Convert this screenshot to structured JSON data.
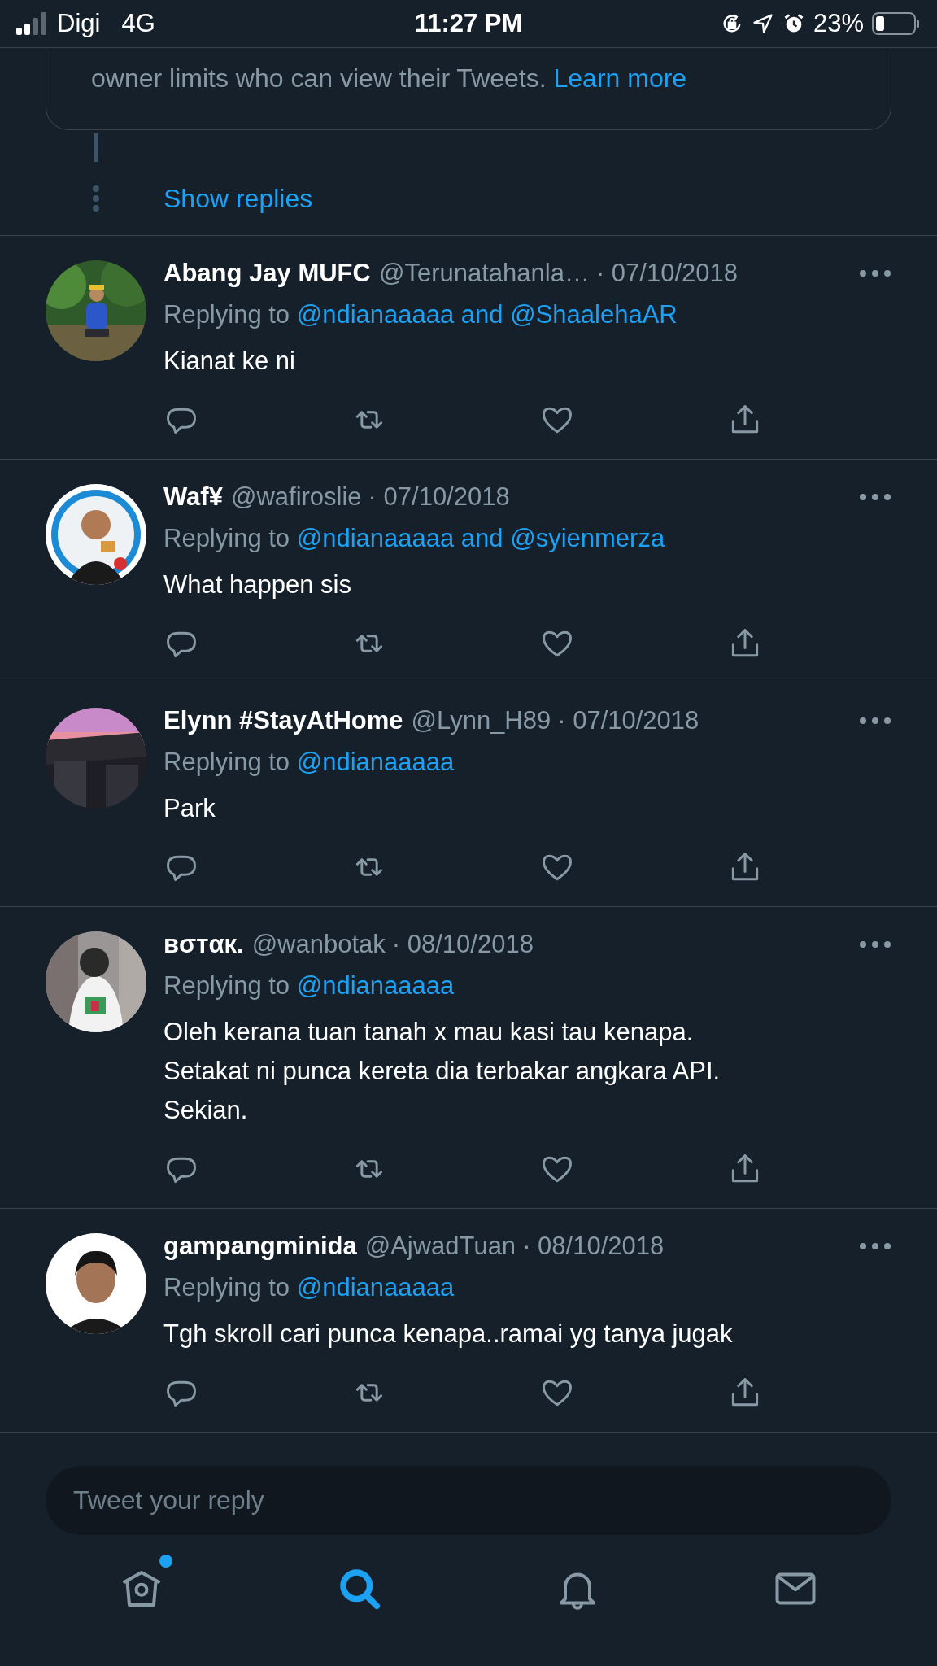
{
  "status_bar": {
    "carrier": "Digi",
    "network": "4G",
    "time": "11:27 PM",
    "battery": "23%"
  },
  "notice": {
    "text": "owner limits who can view their Tweets.",
    "link": "Learn more"
  },
  "show_replies": "Show replies",
  "tweets": [
    {
      "name": "Abang Jay MUFC",
      "handle": "@Terunatahanla…",
      "date": "· 07/10/2018",
      "replying_label": "Replying to",
      "replying_to": "@ndianaaaaa and @ShaalehaAR",
      "text": "Kianat ke ni"
    },
    {
      "name": "Waf¥",
      "handle": "@wafiroslie",
      "date": "· 07/10/2018",
      "replying_label": "Replying to",
      "replying_to": "@ndianaaaaa and @syienmerza",
      "text": "What happen sis"
    },
    {
      "name": "Elynn #StayAtHome",
      "handle": "@Lynn_H89",
      "date": "· 07/10/2018",
      "replying_label": "Replying to",
      "replying_to": "@ndianaaaaa",
      "text": "Park"
    },
    {
      "name": "вσтαк.",
      "handle": "@wanbotak",
      "date": "· 08/10/2018",
      "replying_label": "Replying to",
      "replying_to": "@ndianaaaaa",
      "text": "Oleh kerana tuan tanah x mau kasi tau kenapa.\nSetakat ni punca kereta dia terbakar angkara API.\nSekian."
    },
    {
      "name": "gampangminida",
      "handle": "@AjwadTuan",
      "date": "· 08/10/2018",
      "replying_label": "Replying to",
      "replying_to": "@ndianaaaaa",
      "text": "Tgh skroll cari punca kenapa..ramai yg tanya jugak"
    }
  ],
  "reply_field": {
    "placeholder": "Tweet your reply"
  },
  "nav": [
    {
      "kind": "home",
      "selected": false,
      "badge": true
    },
    {
      "kind": "search",
      "selected": true,
      "badge": false
    },
    {
      "kind": "notifications",
      "selected": false,
      "badge": false
    },
    {
      "kind": "messages",
      "selected": false,
      "badge": false
    }
  ]
}
